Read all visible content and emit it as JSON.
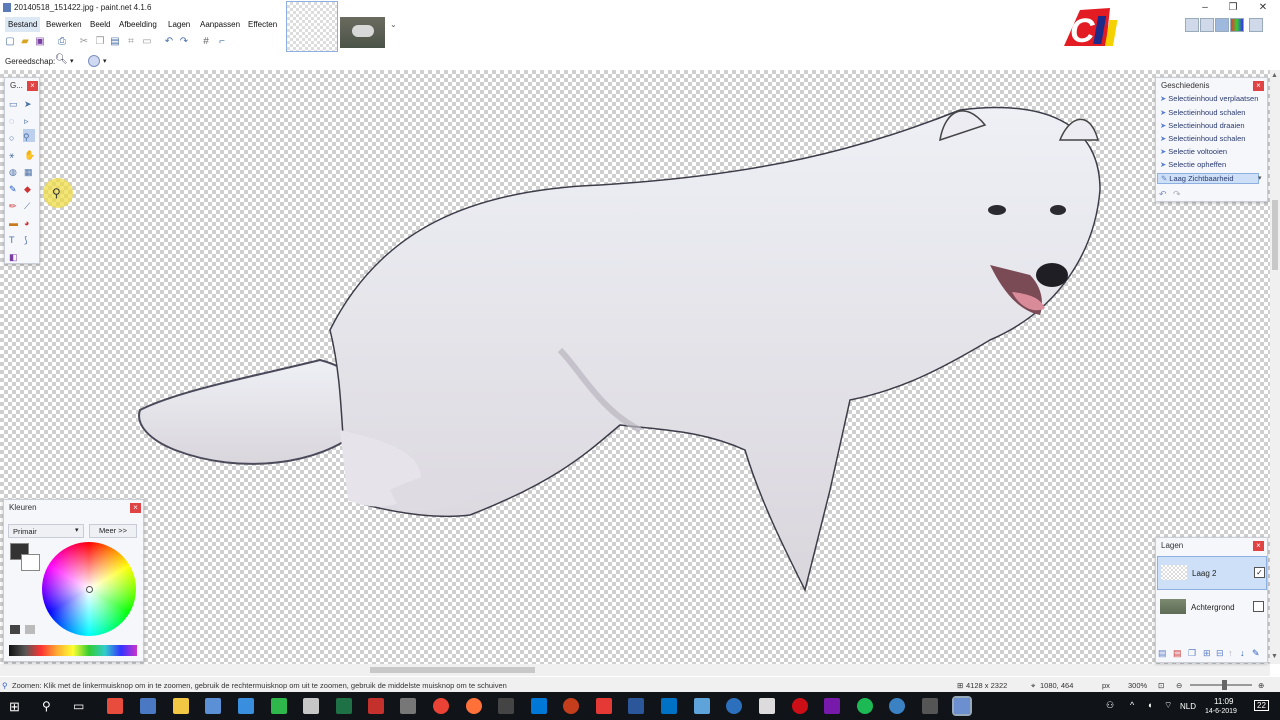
{
  "window": {
    "title": "20140518_151422.jpg - paint.net 4.1.6",
    "buttons": [
      "–",
      "❐",
      "✕"
    ]
  },
  "menu": [
    "Bestand",
    "Bewerken",
    "Beeld",
    "Afbeelding",
    "Lagen",
    "Aanpassen",
    "Effecten"
  ],
  "toolrow2": {
    "label": "Gereedschap:"
  },
  "logo": {
    "text": "CI"
  },
  "tools_panel": {
    "title": "G..."
  },
  "history": {
    "title": "Geschiedenis",
    "items": [
      "Selectieinhoud verplaatsen",
      "Selectieinhoud schalen",
      "Selectieinhoud draaien",
      "Selectieinhoud schalen",
      "Selectie voltooien",
      "Selectie opheffen",
      "Laag Zichtbaarheid"
    ],
    "selected_index": 6
  },
  "colors": {
    "title": "Kleuren",
    "mode": "Primair",
    "more": "Meer >>"
  },
  "layers": {
    "title": "Lagen",
    "items": [
      {
        "name": "Laag 2",
        "checked": true
      },
      {
        "name": "Achtergrond",
        "checked": false
      }
    ]
  },
  "status": {
    "hint": "Zoomen: Klik met de linkermuisknop om in te zoomen, gebruik de rechtermuisknop om uit te zoomen, gebruik de middelste muisknop om te schuiven",
    "size": "4128 x 2322",
    "position": "1080, 464",
    "unit": "px",
    "zoom": "300%"
  },
  "taskbar": {
    "lang": "NLD",
    "time": "11:09",
    "date": "14-6-2019",
    "notif": "22"
  }
}
